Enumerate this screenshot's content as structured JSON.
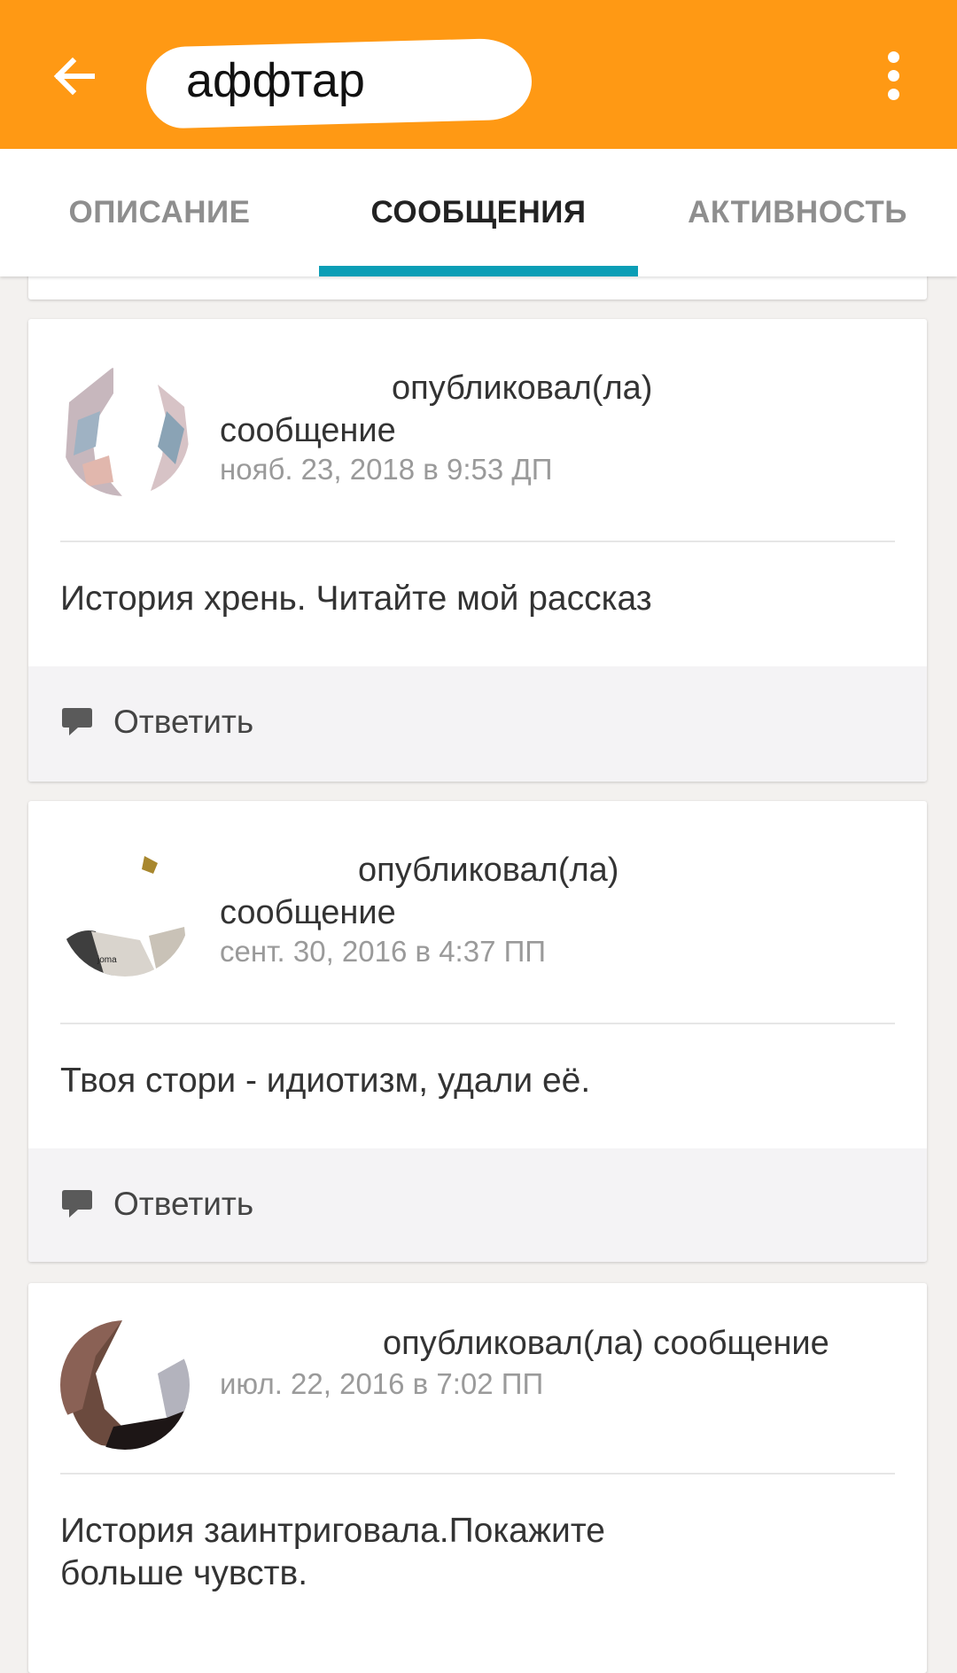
{
  "appbar": {
    "title": "аффтар",
    "back_icon": "arrow-left-icon",
    "menu_icon": "more-vertical-icon",
    "color": "#ff9914"
  },
  "tabs": [
    {
      "label": "ОПИСАНИЕ",
      "active": false
    },
    {
      "label": "СООБЩЕНИЯ",
      "active": true
    },
    {
      "label": "АКТИВНОСТЬ",
      "active": false
    }
  ],
  "accent": "#0b9eb6",
  "messages": [
    {
      "action": "опубликовал(ла)",
      "object": "сообщение",
      "date": "нояб. 23, 2018 в 9:53 ДП",
      "text": "История хрень.  Читайте мой рассказ",
      "reply_label": "Ответить"
    },
    {
      "action": "опубликовал(ла)",
      "object": "сообщение",
      "date": "сент. 30, 2016 в 4:37 ПП",
      "text": "Твоя стори - идиотизм, удали её.",
      "reply_label": "Ответить"
    },
    {
      "action": "опубликовал(ла) сообщение",
      "date": "июл. 22, 2016 в 7:02 ПП",
      "text_line1": "История заинтриговала.Покажите",
      "text_line2": "больше чувств."
    }
  ]
}
